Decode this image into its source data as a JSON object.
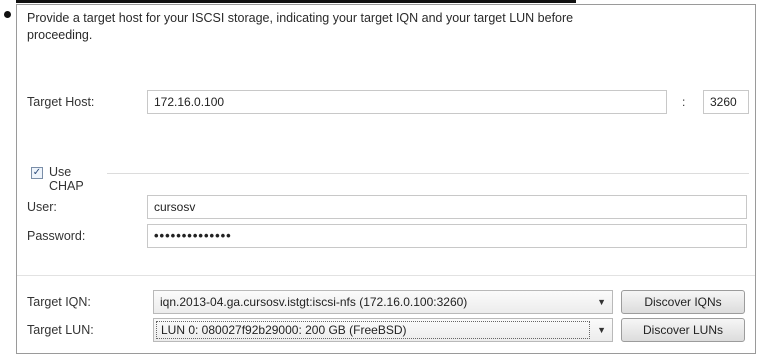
{
  "intro_text": "Provide a target host for your ISCSI storage, indicating your target IQN and your target LUN before proceeding.",
  "target_host": {
    "label": "Target Host:",
    "host_value": "172.16.0.100",
    "separator": ":",
    "port_value": "3260"
  },
  "chap": {
    "checkbox_label": "Use CHAP",
    "checked_glyph": "✓",
    "user_label": "User:",
    "user_value": "cursosv",
    "password_label": "Password:",
    "password_value": "••••••••••••••"
  },
  "target_iqn": {
    "label": "Target IQN:",
    "selected": "iqn.2013-04.ga.cursosv.istgt:iscsi-nfs (172.16.0.100:3260)",
    "button": "Discover IQNs"
  },
  "target_lun": {
    "label": "Target LUN:",
    "selected": "LUN 0: 080027f92b29000: 200 GB (FreeBSD)",
    "button": "Discover LUNs"
  },
  "icons": {
    "dropdown_arrow": "▼"
  }
}
